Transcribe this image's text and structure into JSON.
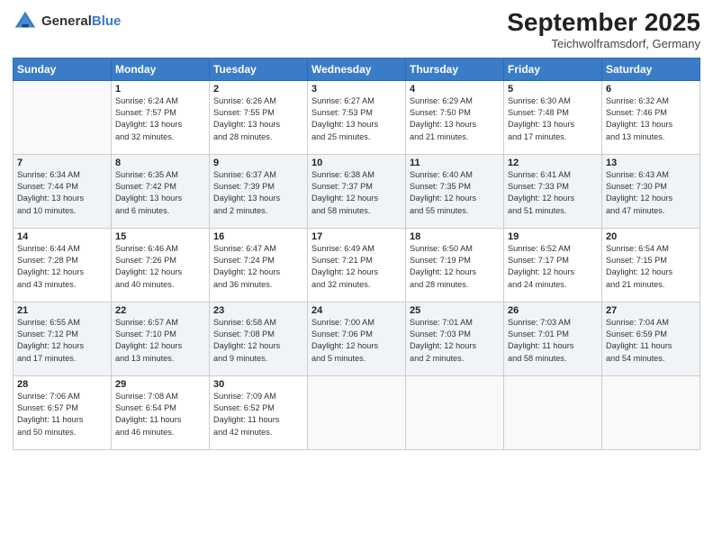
{
  "header": {
    "logo_general": "General",
    "logo_blue": "Blue",
    "title": "September 2025",
    "location": "Teichwolframsdorf, Germany"
  },
  "days_of_week": [
    "Sunday",
    "Monday",
    "Tuesday",
    "Wednesday",
    "Thursday",
    "Friday",
    "Saturday"
  ],
  "weeks": [
    [
      {
        "day": "",
        "info": ""
      },
      {
        "day": "1",
        "info": "Sunrise: 6:24 AM\nSunset: 7:57 PM\nDaylight: 13 hours\nand 32 minutes."
      },
      {
        "day": "2",
        "info": "Sunrise: 6:26 AM\nSunset: 7:55 PM\nDaylight: 13 hours\nand 28 minutes."
      },
      {
        "day": "3",
        "info": "Sunrise: 6:27 AM\nSunset: 7:53 PM\nDaylight: 13 hours\nand 25 minutes."
      },
      {
        "day": "4",
        "info": "Sunrise: 6:29 AM\nSunset: 7:50 PM\nDaylight: 13 hours\nand 21 minutes."
      },
      {
        "day": "5",
        "info": "Sunrise: 6:30 AM\nSunset: 7:48 PM\nDaylight: 13 hours\nand 17 minutes."
      },
      {
        "day": "6",
        "info": "Sunrise: 6:32 AM\nSunset: 7:46 PM\nDaylight: 13 hours\nand 13 minutes."
      }
    ],
    [
      {
        "day": "7",
        "info": "Sunrise: 6:34 AM\nSunset: 7:44 PM\nDaylight: 13 hours\nand 10 minutes."
      },
      {
        "day": "8",
        "info": "Sunrise: 6:35 AM\nSunset: 7:42 PM\nDaylight: 13 hours\nand 6 minutes."
      },
      {
        "day": "9",
        "info": "Sunrise: 6:37 AM\nSunset: 7:39 PM\nDaylight: 13 hours\nand 2 minutes."
      },
      {
        "day": "10",
        "info": "Sunrise: 6:38 AM\nSunset: 7:37 PM\nDaylight: 12 hours\nand 58 minutes."
      },
      {
        "day": "11",
        "info": "Sunrise: 6:40 AM\nSunset: 7:35 PM\nDaylight: 12 hours\nand 55 minutes."
      },
      {
        "day": "12",
        "info": "Sunrise: 6:41 AM\nSunset: 7:33 PM\nDaylight: 12 hours\nand 51 minutes."
      },
      {
        "day": "13",
        "info": "Sunrise: 6:43 AM\nSunset: 7:30 PM\nDaylight: 12 hours\nand 47 minutes."
      }
    ],
    [
      {
        "day": "14",
        "info": "Sunrise: 6:44 AM\nSunset: 7:28 PM\nDaylight: 12 hours\nand 43 minutes."
      },
      {
        "day": "15",
        "info": "Sunrise: 6:46 AM\nSunset: 7:26 PM\nDaylight: 12 hours\nand 40 minutes."
      },
      {
        "day": "16",
        "info": "Sunrise: 6:47 AM\nSunset: 7:24 PM\nDaylight: 12 hours\nand 36 minutes."
      },
      {
        "day": "17",
        "info": "Sunrise: 6:49 AM\nSunset: 7:21 PM\nDaylight: 12 hours\nand 32 minutes."
      },
      {
        "day": "18",
        "info": "Sunrise: 6:50 AM\nSunset: 7:19 PM\nDaylight: 12 hours\nand 28 minutes."
      },
      {
        "day": "19",
        "info": "Sunrise: 6:52 AM\nSunset: 7:17 PM\nDaylight: 12 hours\nand 24 minutes."
      },
      {
        "day": "20",
        "info": "Sunrise: 6:54 AM\nSunset: 7:15 PM\nDaylight: 12 hours\nand 21 minutes."
      }
    ],
    [
      {
        "day": "21",
        "info": "Sunrise: 6:55 AM\nSunset: 7:12 PM\nDaylight: 12 hours\nand 17 minutes."
      },
      {
        "day": "22",
        "info": "Sunrise: 6:57 AM\nSunset: 7:10 PM\nDaylight: 12 hours\nand 13 minutes."
      },
      {
        "day": "23",
        "info": "Sunrise: 6:58 AM\nSunset: 7:08 PM\nDaylight: 12 hours\nand 9 minutes."
      },
      {
        "day": "24",
        "info": "Sunrise: 7:00 AM\nSunset: 7:06 PM\nDaylight: 12 hours\nand 5 minutes."
      },
      {
        "day": "25",
        "info": "Sunrise: 7:01 AM\nSunset: 7:03 PM\nDaylight: 12 hours\nand 2 minutes."
      },
      {
        "day": "26",
        "info": "Sunrise: 7:03 AM\nSunset: 7:01 PM\nDaylight: 11 hours\nand 58 minutes."
      },
      {
        "day": "27",
        "info": "Sunrise: 7:04 AM\nSunset: 6:59 PM\nDaylight: 11 hours\nand 54 minutes."
      }
    ],
    [
      {
        "day": "28",
        "info": "Sunrise: 7:06 AM\nSunset: 6:57 PM\nDaylight: 11 hours\nand 50 minutes."
      },
      {
        "day": "29",
        "info": "Sunrise: 7:08 AM\nSunset: 6:54 PM\nDaylight: 11 hours\nand 46 minutes."
      },
      {
        "day": "30",
        "info": "Sunrise: 7:09 AM\nSunset: 6:52 PM\nDaylight: 11 hours\nand 42 minutes."
      },
      {
        "day": "",
        "info": ""
      },
      {
        "day": "",
        "info": ""
      },
      {
        "day": "",
        "info": ""
      },
      {
        "day": "",
        "info": ""
      }
    ]
  ]
}
